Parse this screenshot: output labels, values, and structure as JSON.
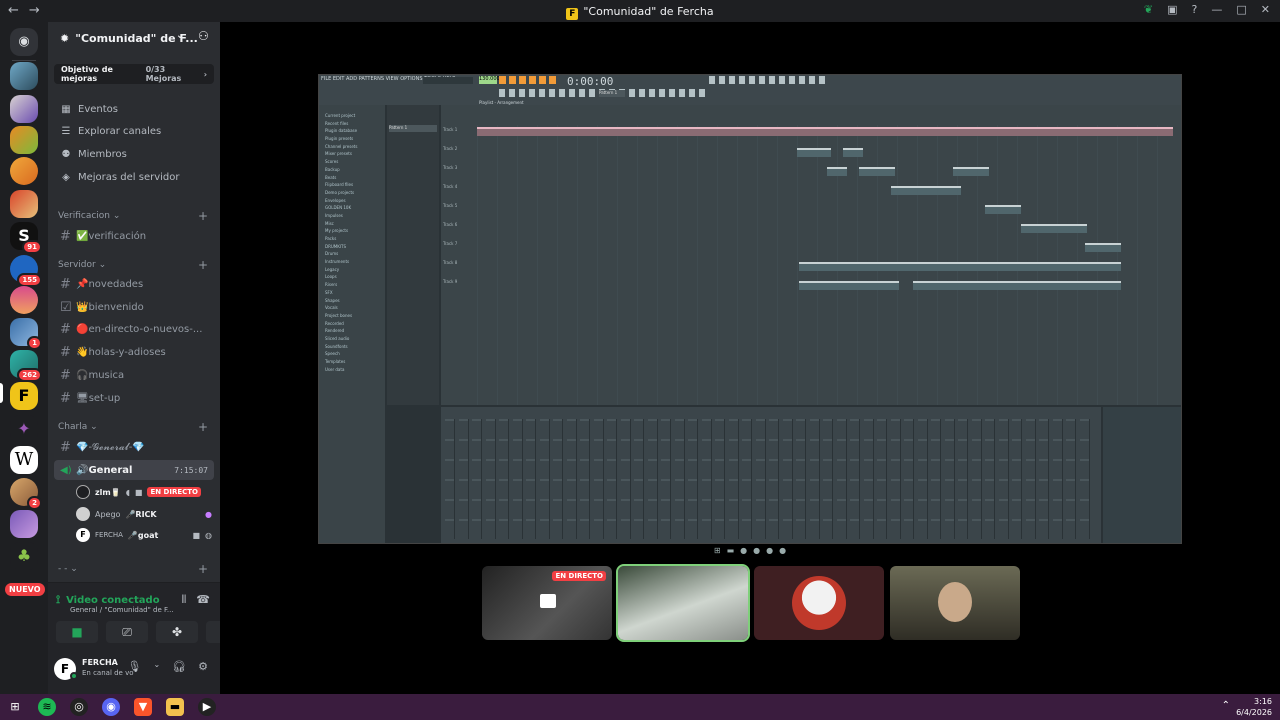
{
  "window": {
    "title": "\"Comunidad\" de Fercha",
    "logo_letter": "F",
    "nav_back": "←",
    "nav_forward": "→"
  },
  "servers": {
    "discord_home": "Discord",
    "badges": [
      "91",
      "155",
      "1",
      "262",
      "2"
    ],
    "new_label": "NUEVO"
  },
  "sidebar": {
    "server_name": "\"Comunidad\" de F...",
    "boost": {
      "label": "Objetivo de mejoras",
      "progress": "0/33 Mejoras"
    },
    "nav": [
      {
        "label": "Eventos",
        "icon": "calendar-icon"
      },
      {
        "label": "Explorar canales",
        "icon": "list-icon"
      },
      {
        "label": "Miembros",
        "icon": "members-icon"
      },
      {
        "label": "Mejoras del servidor",
        "icon": "boost-icon"
      }
    ],
    "categories": {
      "verificacion": "Verificacion",
      "servidor": "Servidor",
      "charla": "Charla",
      "unnamed": "- -"
    },
    "channels_verif": [
      {
        "label": "✅verificación"
      }
    ],
    "channels_servidor": [
      {
        "label": "📌novedades"
      },
      {
        "label": "👑bienvenido"
      },
      {
        "label": "🔴en-directo-o-nuevos-..."
      },
      {
        "label": "👋holas-y-adioses"
      },
      {
        "label": "🎧musica"
      },
      {
        "label": "🖥set-up"
      }
    ],
    "channels_charla": [
      {
        "label": "💎-𝓖𝓮𝓷𝓮𝓻𝓪𝓵-💎"
      },
      {
        "label": "🔊General",
        "time": "7:15:07"
      }
    ],
    "voice_users": [
      {
        "name": "zlm🥛",
        "live": "EN DIRECTO"
      },
      {
        "name": "Apego",
        "tag": "🎤RICK"
      },
      {
        "name": "FERCHA",
        "tag": "🎤goat"
      }
    ]
  },
  "voice_panel": {
    "status": "Video conectado",
    "location": "General / \"Comunidad\" de F..."
  },
  "user": {
    "name": "FERCHA",
    "status": "En canal de vo",
    "initial": "F"
  },
  "stream": {
    "app_menu": "FILE EDIT ADD PATTERNS VIEW OPTIONS TOOLS HELP",
    "tempo": "130.000",
    "time": "0:00:00",
    "playlist_title": "Playlist - Arrangement",
    "pattern": "Pattern 1",
    "tracks": [
      "Track 1",
      "Track 2",
      "Track 3",
      "Track 4",
      "Track 5",
      "Track 6",
      "Track 7",
      "Track 8",
      "Track 9"
    ],
    "browser": [
      "Current project",
      "Recent files",
      "Plugin database",
      "Plugin presets",
      "Channel presets",
      "Mixer presets",
      "Scores",
      "Backup",
      "Beats",
      "Flipboard files",
      "Demo projects",
      "Envelopes",
      "GOLDEN 10K",
      "Impulses",
      "Misc",
      "My projects",
      "Packs",
      "DRUMKITS",
      "Drums",
      "Instruments",
      "Legacy",
      "Loops",
      "Risers",
      "SFX",
      "Shapes",
      "Vocals",
      "Project bones",
      "Recorded",
      "Rendered",
      "Sliced audio",
      "Soundfonts",
      "Speech",
      "Templates",
      "User data"
    ]
  },
  "participants": {
    "live_label": "EN DIRECTO"
  },
  "taskbar": {
    "time": "3:16",
    "date": "6/4/2026"
  },
  "colors": {
    "accent_green": "#23a55a",
    "live_red": "#f23f43",
    "sidebar_bg": "#2b2d31",
    "taskbar_bg": "#3a1c3e"
  }
}
